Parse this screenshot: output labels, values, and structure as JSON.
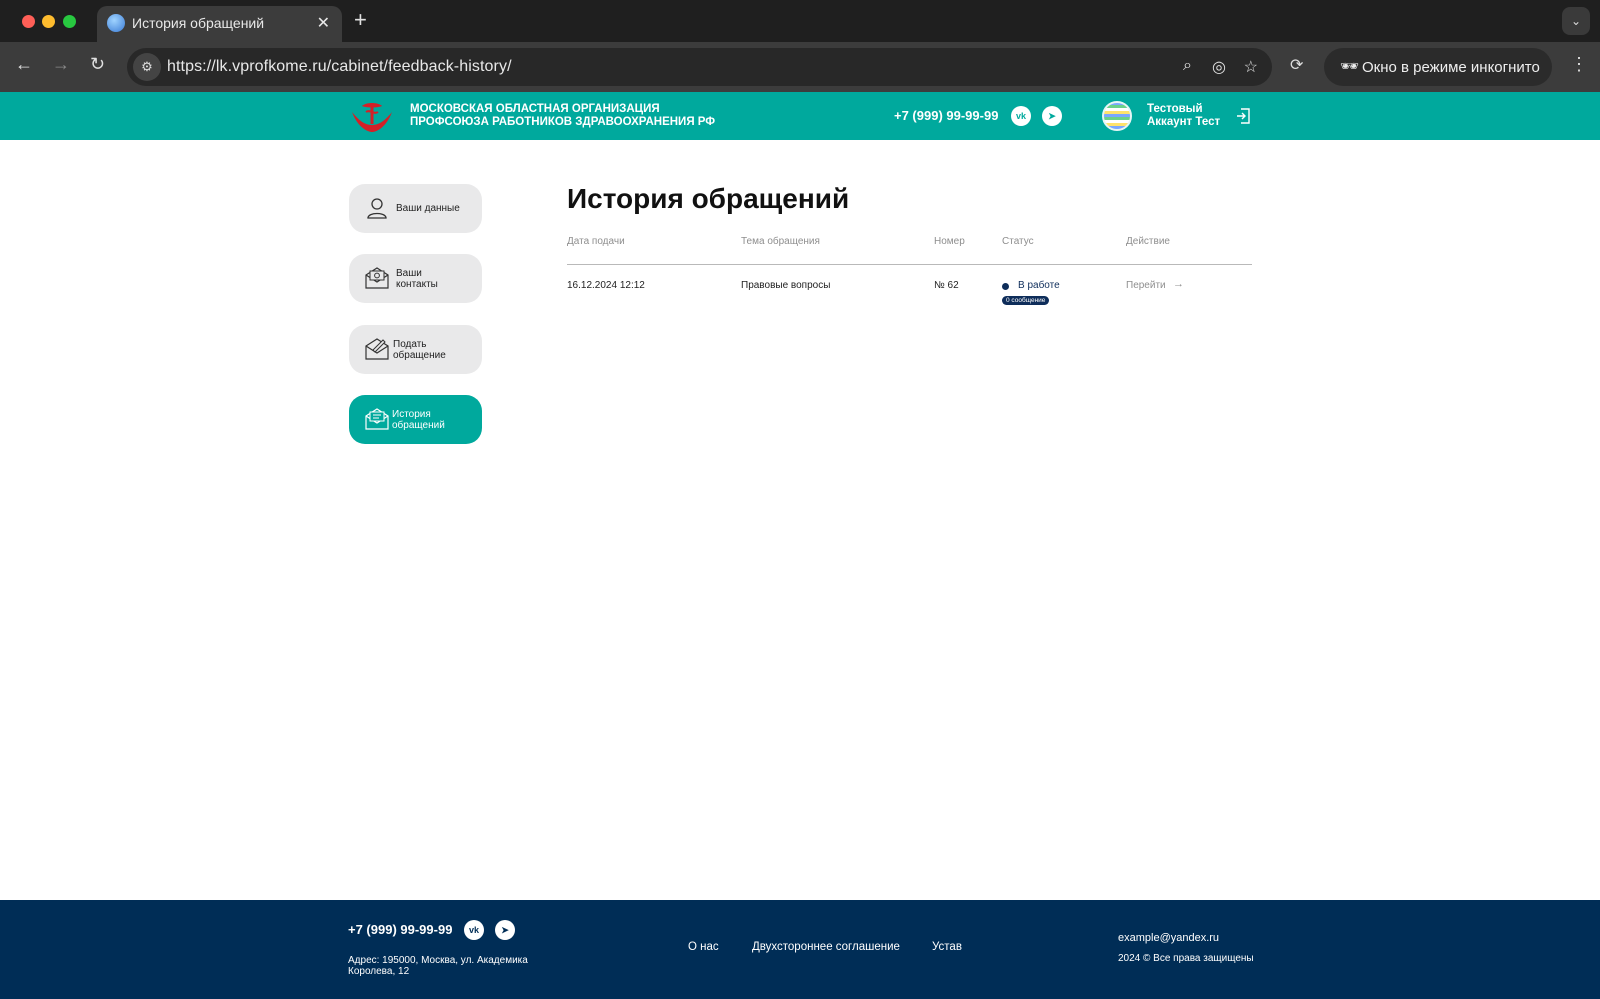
{
  "browser": {
    "tab_title": "История обращений",
    "url": "https://lk.vprofkome.ru/cabinet/feedback-history/",
    "incognito_label": "Окно в режиме инкогнито"
  },
  "header": {
    "org_line1": "Московская областная организация",
    "org_line2": "профсоюза работников здравоохранения РФ",
    "phone": "+7 (999) 99-99-99",
    "account_line1": "Тестовый",
    "account_line2": "Аккаунт Тест"
  },
  "sidebar": {
    "items": [
      {
        "line1": "Ваши данные",
        "line2": "",
        "icon": "user-icon",
        "active": false
      },
      {
        "line1": "Ваши",
        "line2": "контакты",
        "icon": "envelope-at-icon",
        "active": false
      },
      {
        "line1": "Подать",
        "line2": "обращение",
        "icon": "envelope-pen-icon",
        "active": false
      },
      {
        "line1": "История",
        "line2": "обращений",
        "icon": "envelope-history-icon",
        "active": true
      }
    ]
  },
  "main": {
    "title": "История обращений",
    "columns": [
      "Дата подачи",
      "Тема обращения",
      "Номер",
      "Статус",
      "Действие"
    ],
    "rows": [
      {
        "date": "16.12.2024 12:12",
        "topic": "Правовые вопросы",
        "number": "№ 62",
        "status": "В работе",
        "messages_badge": "0 сообщение",
        "action": "Перейти"
      }
    ]
  },
  "footer": {
    "phone": "+7 (999) 99-99-99",
    "address": "Адрес: 195000, Москва, ул. Академика Королева, 12",
    "links": [
      "О нас",
      "Двухстороннее соглашение",
      "Устав"
    ],
    "email": "example@yandex.ru",
    "copyright": "2024 © Все права защищены"
  },
  "colors": {
    "accent": "#00a99d",
    "footer": "#002d56",
    "status": "#0e2d5a"
  }
}
